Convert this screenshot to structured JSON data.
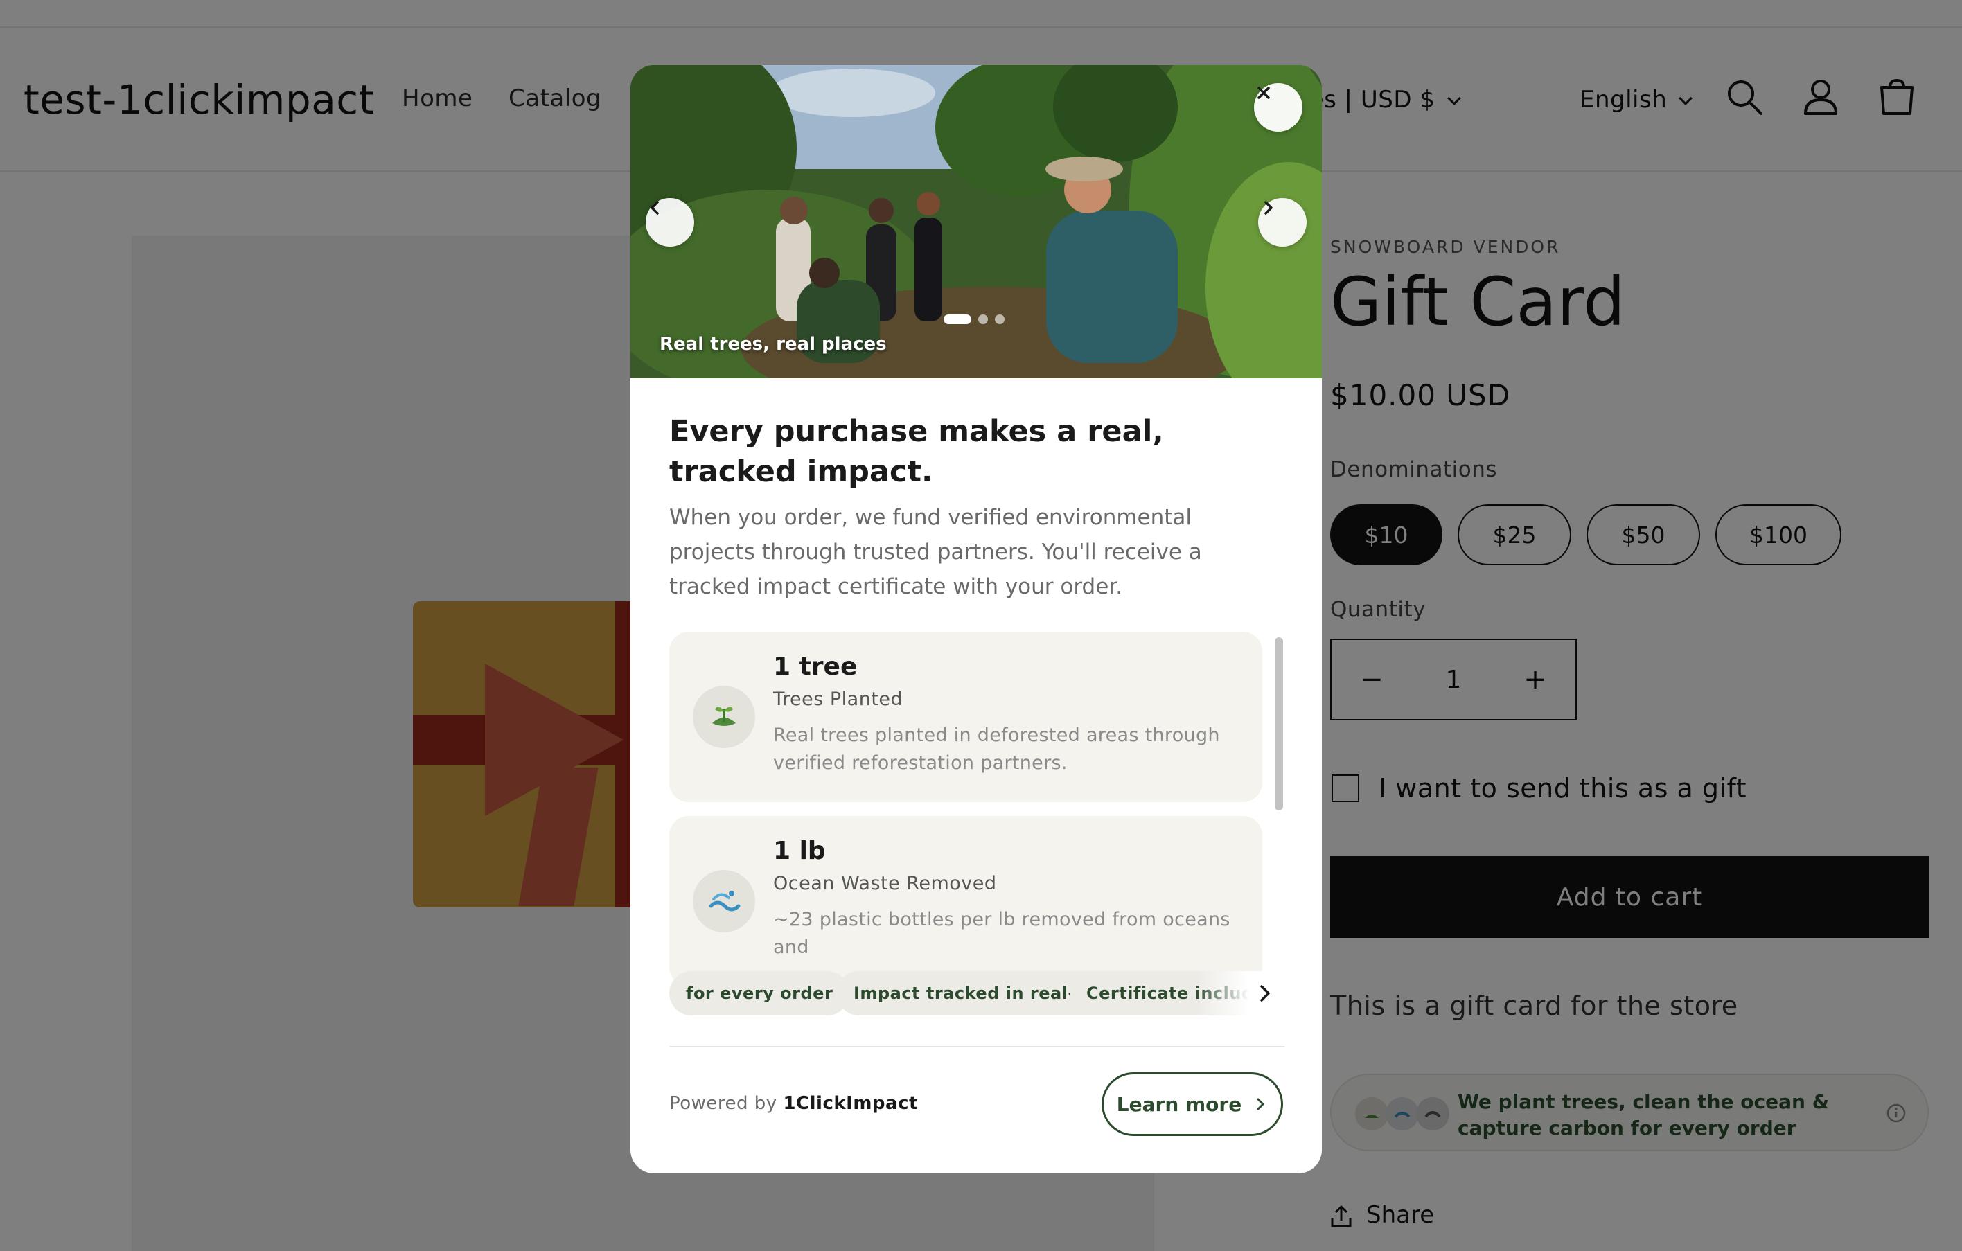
{
  "store": {
    "logo": "test-1clickimpact",
    "nav": [
      "Home",
      "Catalog"
    ],
    "country_selector": "ted States | USD $",
    "language_selector": "English"
  },
  "product": {
    "vendor": "SNOWBOARD VENDOR",
    "title": "Gift Card",
    "price": "$10.00 USD",
    "denominations_label": "Denominations",
    "denominations": [
      "$10",
      "$25",
      "$50",
      "$100"
    ],
    "selected_denomination": "$10",
    "quantity_label": "Quantity",
    "quantity_value": "1",
    "quantity_minus": "−",
    "quantity_plus": "+",
    "gift_checkbox_label": "I want to send this as a gift",
    "add_to_cart": "Add to cart",
    "description": "This is a gift card for the store",
    "impact_badge_text": "We plant trees, clean the ocean & capture carbon for every order",
    "share_label": "Share"
  },
  "modal": {
    "hero_caption": "Real trees, real places",
    "carousel_total": 3,
    "carousel_active": 1,
    "heading": "Every purchase makes a real, tracked impact.",
    "subtext": "When you order, we fund verified environmental projects through trusted partners. You'll receive a tracked impact certificate with your order.",
    "impacts": [
      {
        "value": "1 tree",
        "label": "Trees Planted",
        "description": "Real trees planted in deforested areas through verified reforestation partners.",
        "icon": "sprout-icon"
      },
      {
        "value": "1 lb",
        "label": "Ocean Waste Removed",
        "description": "~23 plastic bottles per lb removed from oceans and",
        "icon": "wave-icon"
      }
    ],
    "chips": [
      "for every order",
      "Impact tracked in real-time",
      "Certificate included"
    ],
    "powered_by_prefix": "Powered by",
    "powered_by_brand": "1ClickImpact",
    "learn_more": "Learn more"
  },
  "colors": {
    "brand_green": "#2c4a2e",
    "overlay": "rgba(0,0,0,0.5)",
    "button_dark": "#121212"
  }
}
